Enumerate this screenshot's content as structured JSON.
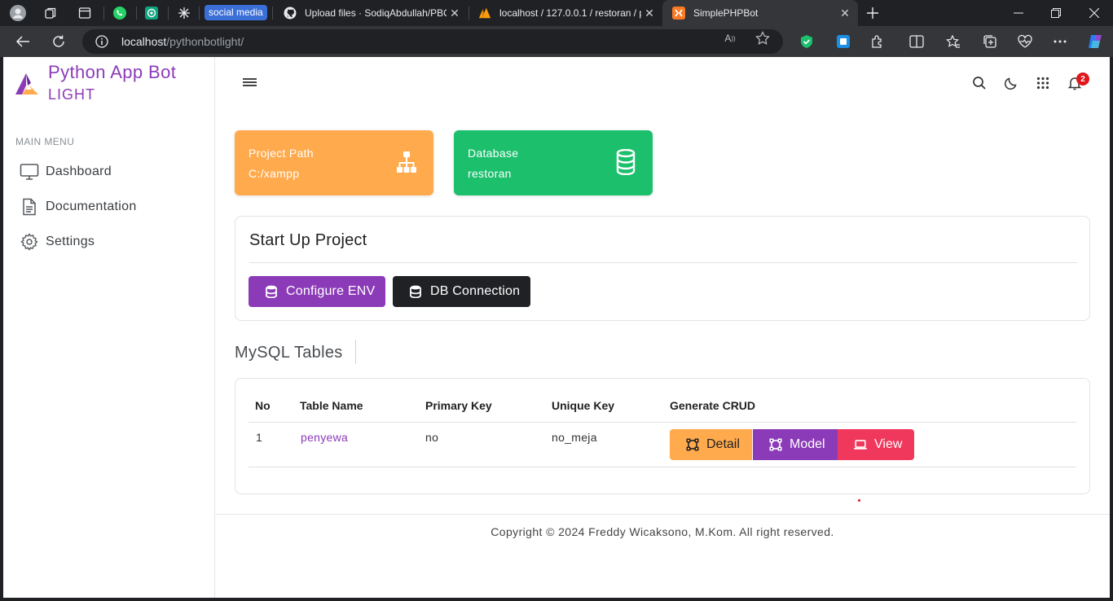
{
  "browser": {
    "tab_group_label": "social media",
    "tabs": [
      {
        "title": "Upload files · SodiqAbdullah/PBO",
        "icon": "github-icon"
      },
      {
        "title": "localhost / 127.0.0.1 / restoran / p",
        "icon": "phpmyadmin-icon"
      },
      {
        "title": "SimplePHPBot",
        "icon": "xampp-icon",
        "active": true
      }
    ],
    "address": {
      "host": "localhost",
      "path": "/pythonbotlight/"
    },
    "accent_color": "#3b6fd8"
  },
  "sidebar": {
    "brand_title": "Python App Bot",
    "brand_subtitle": "LIGHT",
    "menu_header": "MAIN MENU",
    "items": [
      {
        "label": "Dashboard",
        "icon": "monitor-icon"
      },
      {
        "label": "Documentation",
        "icon": "document-icon"
      },
      {
        "label": "Settings",
        "icon": "gear-icon"
      }
    ]
  },
  "topbar": {
    "notification_count": "2"
  },
  "cards": [
    {
      "label": "Project Path",
      "value": "C:/xampp",
      "icon": "sitemap-icon",
      "color": "#ffaa4c"
    },
    {
      "label": "Database",
      "value": "restoran",
      "icon": "database-icon",
      "color": "#1bbf6c"
    }
  ],
  "startup": {
    "title": "Start Up Project",
    "buttons": [
      {
        "label": "Configure ENV",
        "icon": "database-icon",
        "color": "#8c3bb8"
      },
      {
        "label": "DB Connection",
        "icon": "database-icon",
        "color": "#1f2124"
      }
    ]
  },
  "mysql": {
    "title": "MySQL Tables",
    "columns": [
      "No",
      "Table Name",
      "Primary Key",
      "Unique Key",
      "Generate CRUD"
    ],
    "rows": [
      {
        "no": "1",
        "table_name": "penyewa",
        "primary_key": "no",
        "unique_key": "no_meja"
      }
    ],
    "crud_buttons": [
      {
        "label": "Detail",
        "icon": "vector-square-icon",
        "color": "#ffaa4c"
      },
      {
        "label": "Model",
        "icon": "vector-square-icon",
        "color": "#8c3bb8"
      },
      {
        "label": "View",
        "icon": "laptop-icon",
        "color": "#f0385d"
      }
    ]
  },
  "footer": {
    "text": "Copyright © 2024 Freddy Wicaksono, M.Kom. All right reserved."
  }
}
